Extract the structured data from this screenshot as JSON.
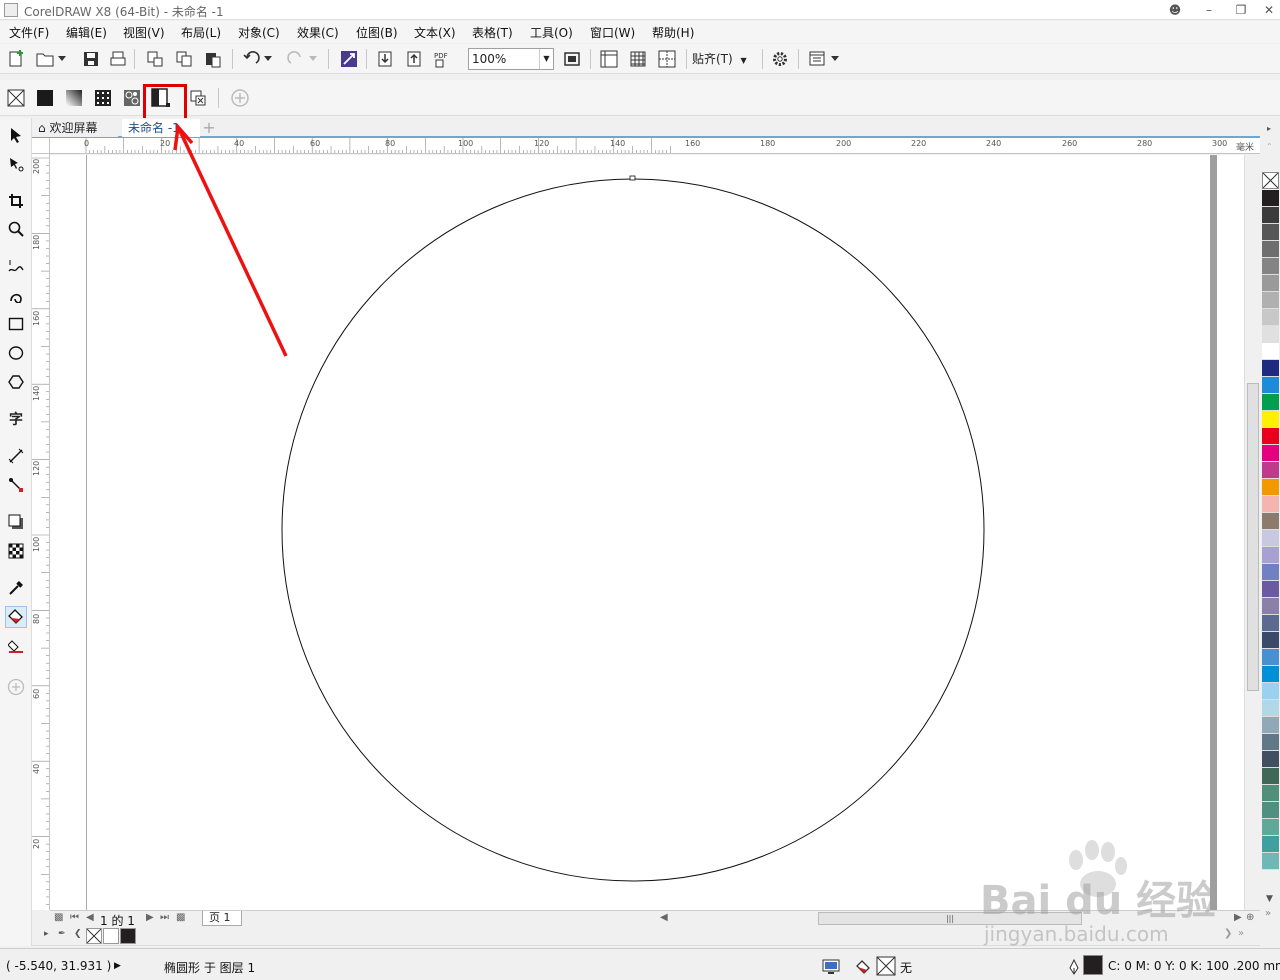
{
  "window": {
    "title": "CorelDRAW X8 (64-Bit) - 未命名 -1"
  },
  "menu": [
    "文件(F)",
    "编辑(E)",
    "视图(V)",
    "布局(L)",
    "对象(C)",
    "效果(C)",
    "位图(B)",
    "文本(X)",
    "表格(T)",
    "工具(O)",
    "窗口(W)",
    "帮助(H)"
  ],
  "toolbar": {
    "zoom": "100%",
    "snap_label": "贴齐(T)"
  },
  "tabs": {
    "welcome": "欢迎屏幕",
    "document": "未命名 -1"
  },
  "ruler": {
    "unit": "毫米",
    "h_ticks": [
      "0",
      "20",
      "40",
      "60",
      "80",
      "100",
      "120",
      "140",
      "160",
      "180",
      "200",
      "220",
      "240",
      "260",
      "280",
      "300"
    ],
    "v_ticks": [
      "200",
      "180",
      "160",
      "140",
      "120",
      "100",
      "80",
      "60",
      "40",
      "20"
    ]
  },
  "pagebar": {
    "counter": "1 的 1",
    "page_label": "页 1"
  },
  "status": {
    "coords": "( -5.540, 31.931 )",
    "object_info": "椭圆形 于 图层 1",
    "fill_none": "无",
    "outline_info": "C: 0 M: 0 Y: 0 K: 100  .200 mm"
  },
  "colors": {
    "accent_red": "#e00000",
    "palette": [
      "#231f20",
      "#3c3c3c",
      "#575757",
      "#6e6e6e",
      "#848484",
      "#9a9a9a",
      "#b0b0b0",
      "#c8c8c8",
      "#e0e0e0",
      "#ffffff",
      "#1e2a80",
      "#1e8ad8",
      "#00a050",
      "#fff000",
      "#e8001c",
      "#e5007f",
      "#c03a8c",
      "#f39800",
      "#f4b4b0",
      "#8c7a6c",
      "#c8c8e0",
      "#a8a0d0",
      "#7080c0",
      "#6a5aa0",
      "#8a80a8",
      "#5a6a90",
      "#3c4a6a",
      "#4a90d0",
      "#0090d8",
      "#9ad0f0",
      "#b0d8e8",
      "#90a8b8",
      "#607888",
      "#405060",
      "#406858",
      "#50907a",
      "#509080",
      "#60a898",
      "#40a0a0",
      "#70b8b8"
    ]
  },
  "watermark": {
    "brand": "Bai du 经验",
    "url": "jingyan.baidu.com"
  }
}
